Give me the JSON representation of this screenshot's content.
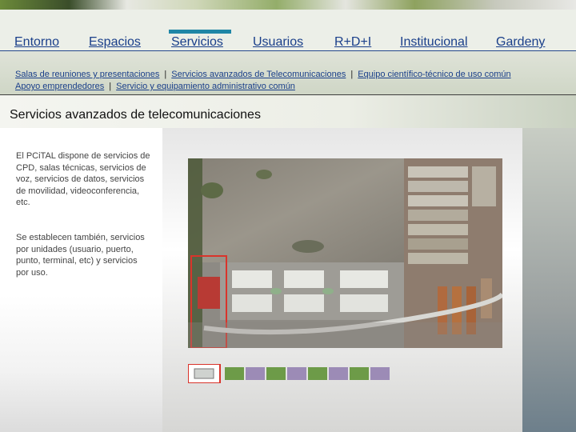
{
  "nav": {
    "tabs": [
      {
        "label": "Entorno"
      },
      {
        "label": "Espacios"
      },
      {
        "label": "Servicios",
        "active": true
      },
      {
        "label": "Usuarios"
      },
      {
        "label": "R+D+I"
      },
      {
        "label": "Institucional"
      },
      {
        "label": "Gardeny"
      }
    ]
  },
  "subnav": {
    "row1": [
      "Salas de reuniones y presentaciones",
      "Servicios avanzados de Telecomunicaciones",
      "Equipo científico-técnico de uso común"
    ],
    "row2": [
      "Apoyo emprendedores",
      "Servicio y equipamiento administrativo común"
    ],
    "separator": "|"
  },
  "page": {
    "title": "Servicios avanzados de telecomunicaciones",
    "paragraph1": "El PCiTAL dispone de servicios de CPD, salas técnicas, servicios de voz, servicios de datos, servicios de movilidad, videoconferencia, etc.",
    "paragraph2": "Se establecen también, servicios por unidades (usuario, puerto, punto, terminal, etc) y servicios por uso."
  },
  "colors": {
    "link": "#1a3f8a",
    "active_tab_bar": "#1f86a6",
    "highlight_box": "#d9342b"
  },
  "image": {
    "kind": "aerial-site-plan"
  }
}
